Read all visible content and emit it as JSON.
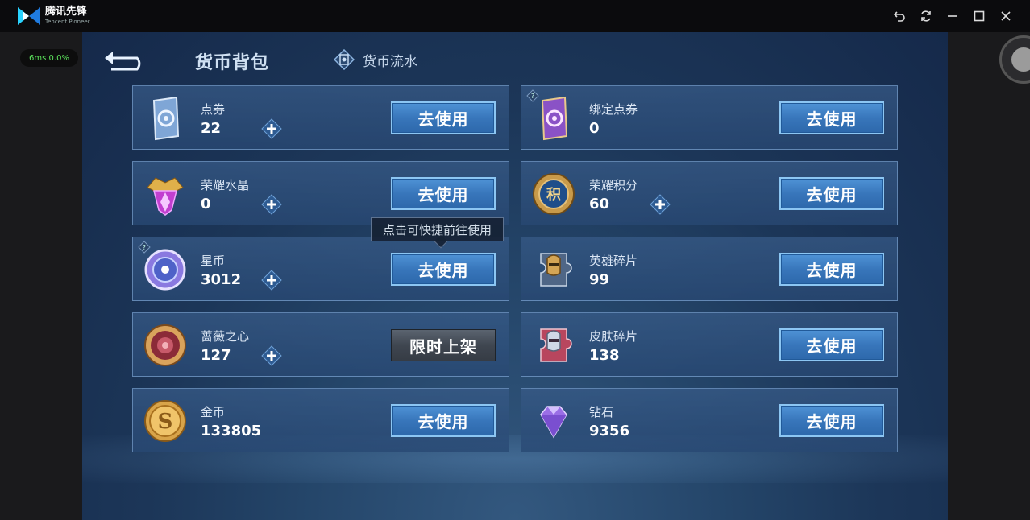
{
  "window": {
    "app_name": "腾讯先锋",
    "app_subtitle": "Tencent Pioneer",
    "perf_text": "6ms 0.0%",
    "controls": [
      "undo-icon",
      "refresh-icon",
      "minimize-icon",
      "maximize-icon",
      "close-icon"
    ]
  },
  "header": {
    "active_tab": "货币背包",
    "other_tab": "货币流水"
  },
  "tooltip": "点击可快捷前往使用",
  "button_labels": {
    "use": "去使用",
    "limited": "限时上架"
  },
  "currencies_left": [
    {
      "name": "点券",
      "count": "22",
      "has_plus": true,
      "button": "去使用",
      "icon": "coupon-icon",
      "help": false
    },
    {
      "name": "荣耀水晶",
      "count": "0",
      "has_plus": true,
      "button": "去使用",
      "icon": "glory-crystal-icon",
      "help": false
    },
    {
      "name": "星币",
      "count": "3012",
      "has_plus": true,
      "button": "去使用",
      "icon": "star-coin-icon",
      "help": true
    },
    {
      "name": "蔷薇之心",
      "count": "127",
      "has_plus": true,
      "button": "限时上架",
      "icon": "rose-heart-icon",
      "help": false
    },
    {
      "name": "金币",
      "count": "133805",
      "has_plus": false,
      "button": "去使用",
      "icon": "gold-coin-icon",
      "help": false
    }
  ],
  "currencies_right": [
    {
      "name": "绑定点券",
      "count": "0",
      "has_plus": false,
      "button": "去使用",
      "icon": "bound-coupon-icon",
      "help": true
    },
    {
      "name": "荣耀积分",
      "count": "60",
      "has_plus": true,
      "button": "去使用",
      "icon": "glory-points-icon",
      "help": false
    },
    {
      "name": "英雄碎片",
      "count": "99",
      "has_plus": false,
      "button": "去使用",
      "icon": "hero-fragment-icon",
      "help": false
    },
    {
      "name": "皮肤碎片",
      "count": "138",
      "has_plus": false,
      "button": "去使用",
      "icon": "skin-fragment-icon",
      "help": false
    },
    {
      "name": "钻石",
      "count": "9356",
      "has_plus": false,
      "button": "去使用",
      "icon": "diamond-icon",
      "help": false
    }
  ],
  "glory_points_glyph": "积"
}
